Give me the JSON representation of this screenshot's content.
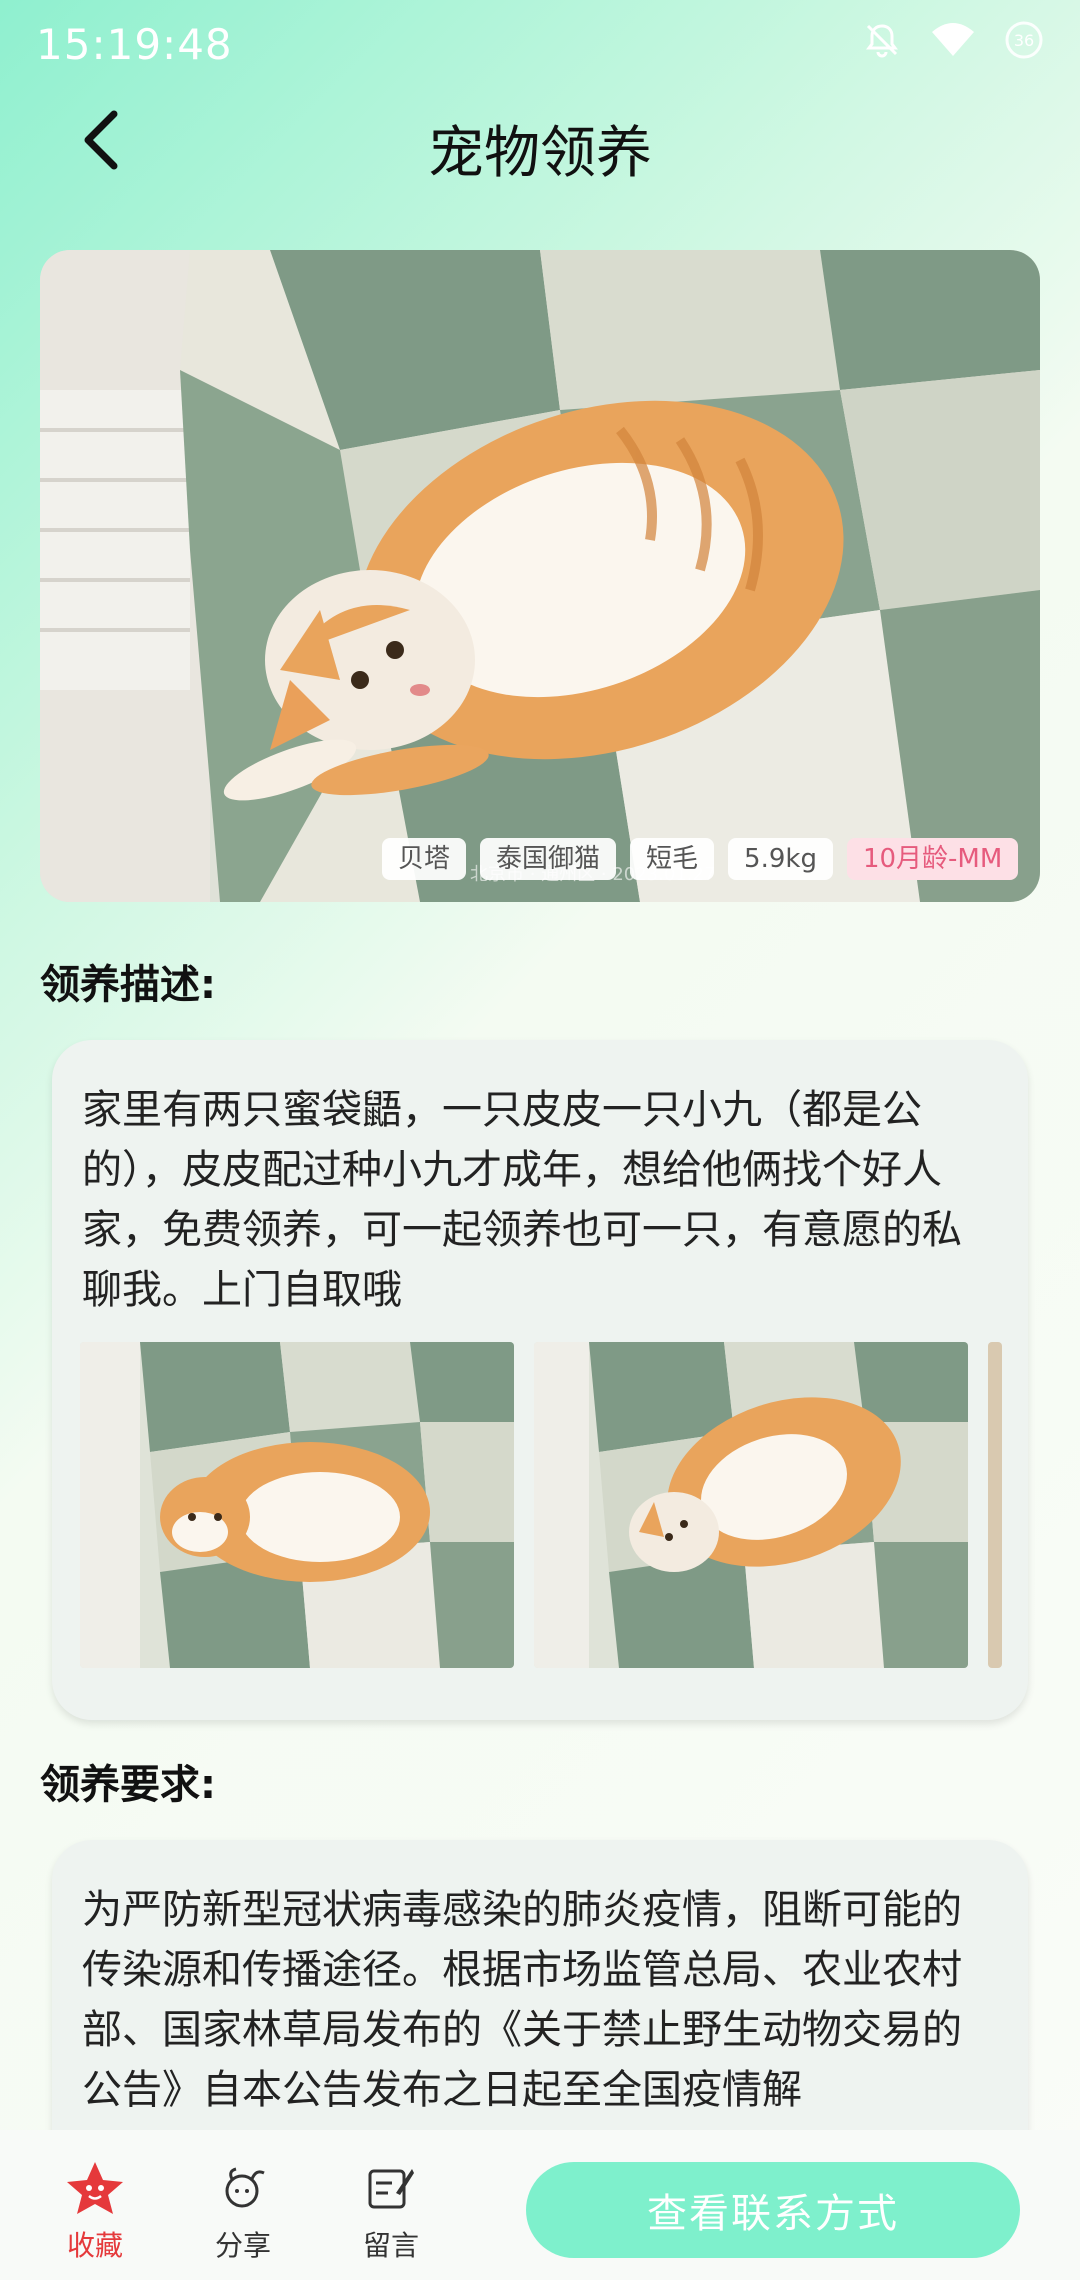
{
  "status": {
    "time": "15:19:48",
    "icons": [
      "bell-muted-icon",
      "wifi-icon",
      "battery-icon"
    ],
    "battery_level": "36"
  },
  "header": {
    "title": "宠物领养",
    "back_icon": "chevron-left-icon"
  },
  "pet": {
    "tags": [
      "贝塔",
      "泰国御猫",
      "短毛",
      "5.9kg",
      "10月龄-MM"
    ],
    "tag_highlight_color": "#e65b7d"
  },
  "description": {
    "heading": "领养描述:",
    "text": "家里有两只蜜袋鼯，一只皮皮一只小九（都是公的），皮皮配过种小九才成年，想给他俩找个好人家，免费领养，可一起领养也可一只，有意愿的私聊我。上门自取哦",
    "photo_count_visible": 3
  },
  "requirements": {
    "heading": "领养要求:",
    "text": "为严防新型冠状病毒感染的肺炎疫情，阻断可能的传染源和传播途径。根据市场监管总局、农业农村部、国家林草局发布的《关于禁止野生动物交易的公告》自本公告发布之日起至全国疫情解"
  },
  "bottom_bar": {
    "favorite_label": "收藏",
    "share_label": "分享",
    "comment_label": "留言",
    "contact_label": "查看联系方式",
    "active_color": "#e5393b",
    "accent_color": "#7ef0cc"
  }
}
